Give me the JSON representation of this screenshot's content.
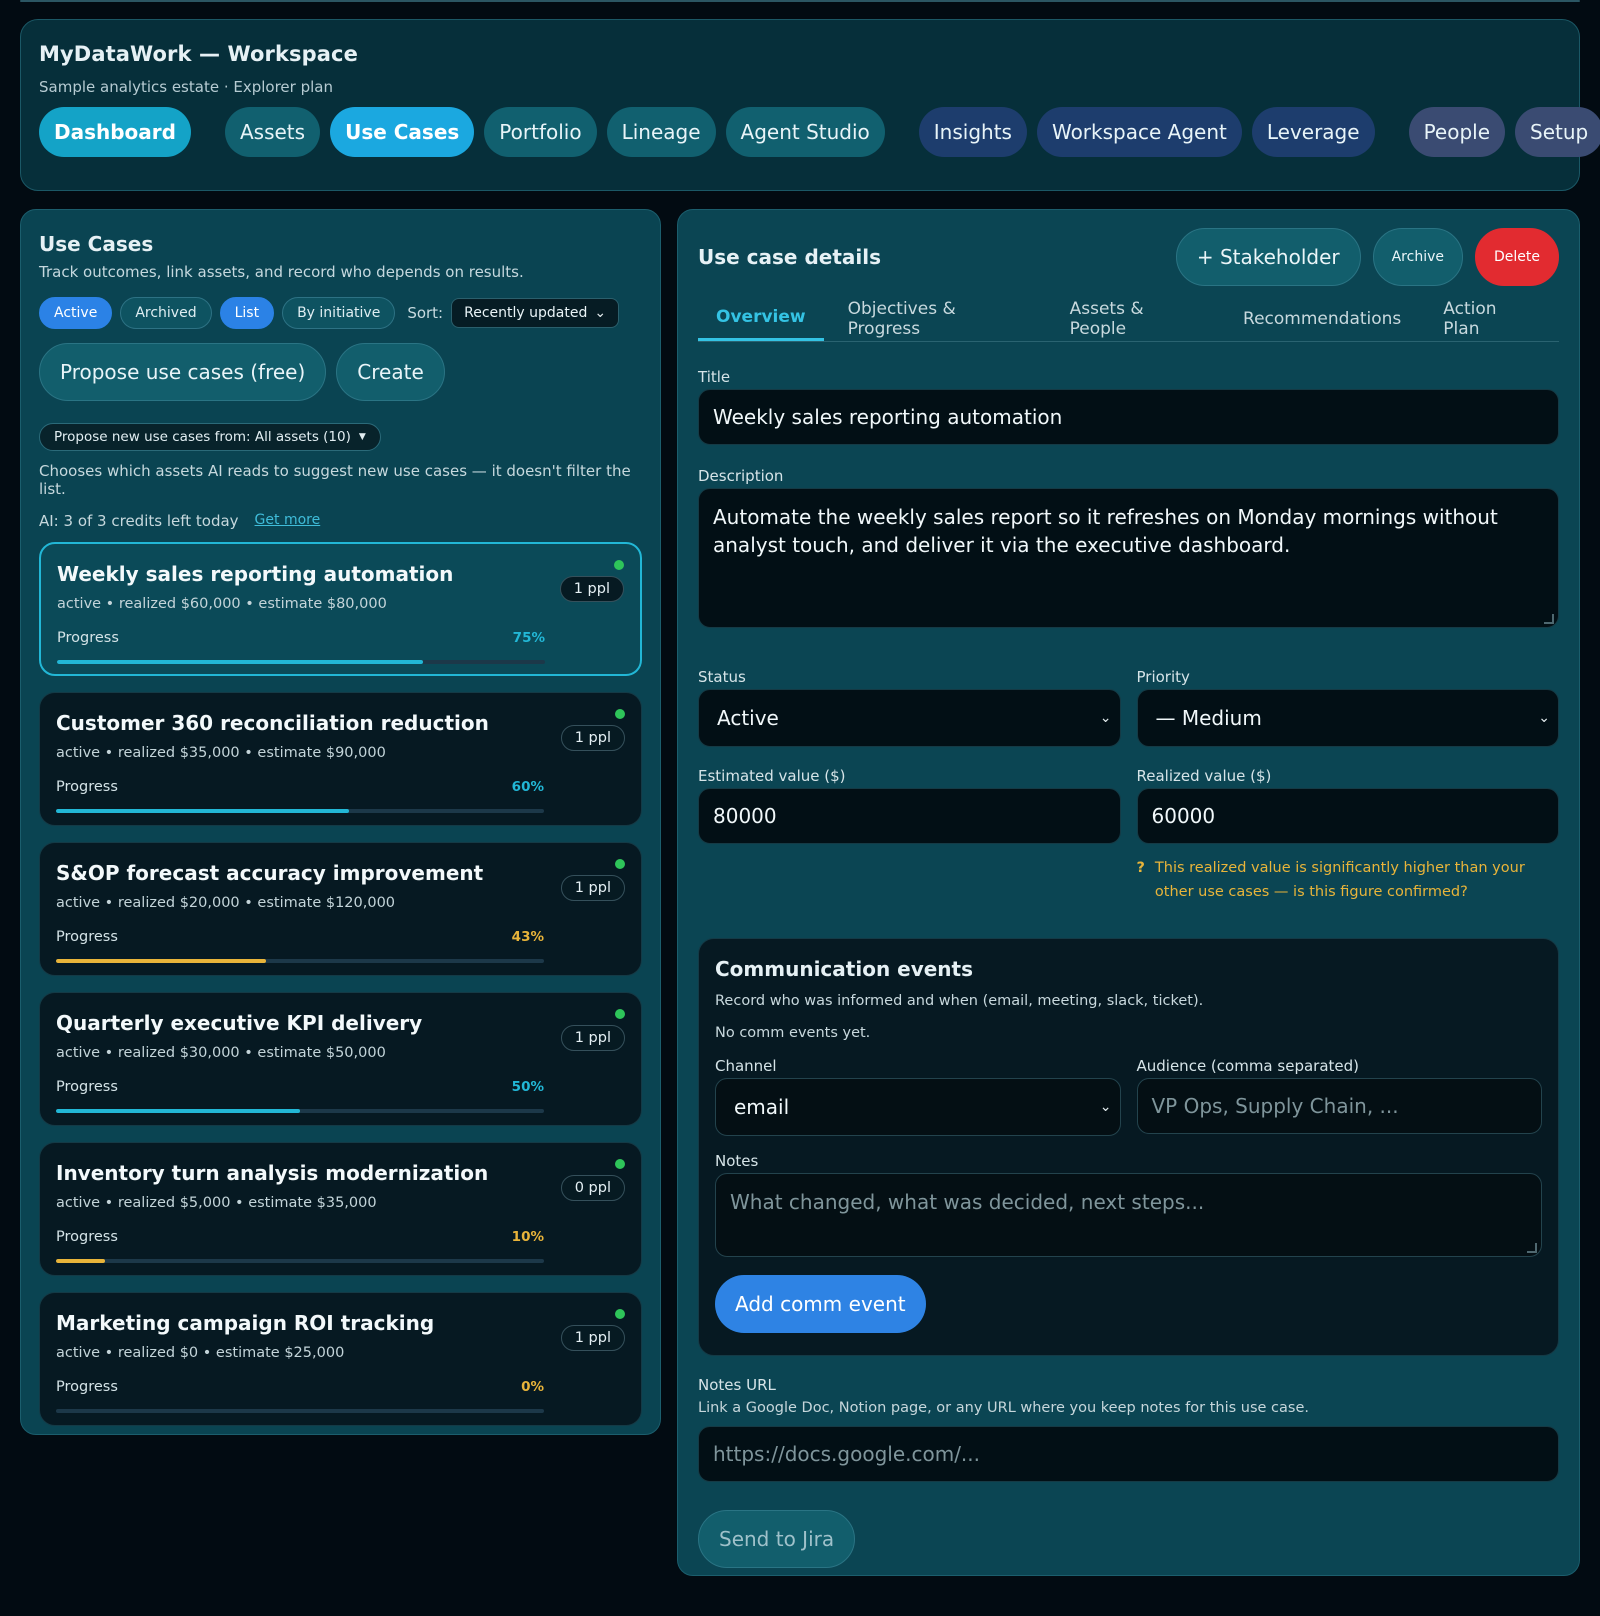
{
  "header": {
    "title": "MyDataWork — Workspace",
    "subtitle": "Sample analytics estate · Explorer plan",
    "nav": [
      {
        "label": "Dashboard"
      },
      {
        "label": "Assets"
      },
      {
        "label": "Use Cases"
      },
      {
        "label": "Portfolio"
      },
      {
        "label": "Lineage"
      },
      {
        "label": "Agent Studio"
      },
      {
        "label": "Insights"
      },
      {
        "label": "Workspace Agent"
      },
      {
        "label": "Leverage"
      },
      {
        "label": "People"
      },
      {
        "label": "Setup"
      }
    ]
  },
  "use_cases_panel": {
    "title": "Use Cases",
    "subtitle": "Track outcomes, link assets, and record who depends on results.",
    "filters": {
      "active": "Active",
      "archived": "Archived",
      "list": "List",
      "by_initiative": "By initiative",
      "sort_label": "Sort:",
      "sort_value": "Recently updated"
    },
    "propose_button": "Propose use cases (free)",
    "create_button": "Create",
    "source_chip": "Propose new use cases from: All assets (10)",
    "source_hint": "Chooses which assets AI reads to suggest new use cases — it doesn't filter the list.",
    "credits_text": "AI: 3 of 3 credits left today",
    "get_more": "Get more",
    "progress_label": "Progress",
    "items": [
      {
        "title": "Weekly sales reporting automation",
        "meta": "active • realized $60,000 • estimate $80,000",
        "ppl": "1 ppl",
        "pct": "75%",
        "progress": 0.75,
        "color": "#22b7d6"
      },
      {
        "title": "Customer 360 reconciliation reduction",
        "meta": "active • realized $35,000 • estimate $90,000",
        "ppl": "1 ppl",
        "pct": "60%",
        "progress": 0.6,
        "color": "#22b7d6"
      },
      {
        "title": "S&OP forecast accuracy improvement",
        "meta": "active • realized $20,000 • estimate $120,000",
        "ppl": "1 ppl",
        "pct": "43%",
        "progress": 0.43,
        "color": "#e8b43a"
      },
      {
        "title": "Quarterly executive KPI delivery",
        "meta": "active • realized $30,000 • estimate $50,000",
        "ppl": "1 ppl",
        "pct": "50%",
        "progress": 0.5,
        "color": "#22b7d6"
      },
      {
        "title": "Inventory turn analysis modernization",
        "meta": "active • realized $5,000 • estimate $35,000",
        "ppl": "0 ppl",
        "pct": "10%",
        "progress": 0.1,
        "color": "#e8b43a"
      },
      {
        "title": "Marketing campaign ROI tracking",
        "meta": "active • realized $0 • estimate $25,000",
        "ppl": "1 ppl",
        "pct": "0%",
        "progress": 0.0,
        "color": "#e8b43a"
      }
    ]
  },
  "details": {
    "title": "Use case details",
    "stakeholder_button": "+ Stakeholder",
    "archive_button": "Archive",
    "delete_button": "Delete",
    "tabs": [
      "Overview",
      "Objectives & Progress",
      "Assets & People",
      "Recommendations",
      "Action Plan"
    ],
    "title_label": "Title",
    "title_value": "Weekly sales reporting automation",
    "description_label": "Description",
    "description_value": "Automate the weekly sales report so it refreshes on Monday mornings without analyst touch, and deliver it via the executive dashboard.",
    "status_label": "Status",
    "status_value": "Active",
    "priority_label": "Priority",
    "priority_value": "— Medium",
    "estimated_label": "Estimated value ($)",
    "estimated_value": "80000",
    "realized_label": "Realized value ($)",
    "realized_value": "60000",
    "warning_icon": "?",
    "warning_text": "This realized value is significantly higher than your other use cases — is this figure confirmed?",
    "comm": {
      "title": "Communication events",
      "subtitle": "Record who was informed and when (email, meeting, slack, ticket).",
      "empty": "No comm events yet.",
      "channel_label": "Channel",
      "channel_value": "email",
      "audience_label": "Audience (comma separated)",
      "audience_placeholder": "VP Ops, Supply Chain, ...",
      "notes_label": "Notes",
      "notes_placeholder": "What changed, what was decided, next steps...",
      "add_button": "Add comm event"
    },
    "notes_url_label": "Notes URL",
    "notes_url_hint": "Link a Google Doc, Notion page, or any URL where you keep notes for this use case.",
    "notes_url_placeholder": "https://docs.google.com/...",
    "jira_button": "Send to Jira"
  }
}
